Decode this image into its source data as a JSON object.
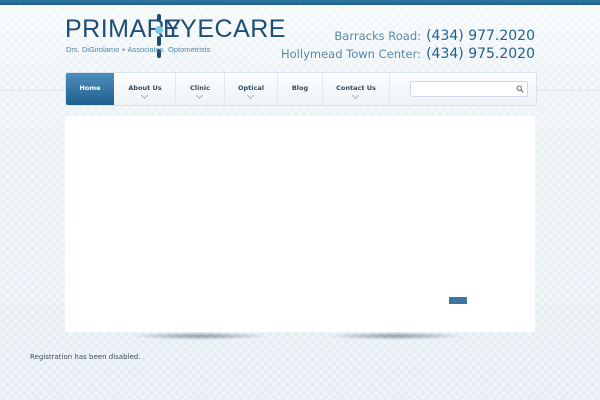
{
  "logo": {
    "primary": "PRIMARY",
    "eyecare": "EYECARE",
    "subtitle_left": "Drs. DiGirolamo + Associates",
    "subtitle_right": "Optometrists"
  },
  "contact": [
    {
      "label": "Barracks Road:",
      "number": "(434) 977.2020"
    },
    {
      "label": "Hollymead Town Center:",
      "number": "(434) 975.2020"
    }
  ],
  "nav": {
    "items": [
      {
        "label": "Home",
        "active": true
      },
      {
        "label": "About Us"
      },
      {
        "label": "Clinic"
      },
      {
        "label": "Optical"
      },
      {
        "label": "Blog"
      },
      {
        "label": "Contact Us"
      }
    ]
  },
  "search": {
    "value": "",
    "placeholder": ""
  },
  "footer": {
    "notice": "Registration has been disabled."
  },
  "colors": {
    "brand": "#1d4e76",
    "accent": "#7cc7e9",
    "nav_active": "#2f6f9e"
  }
}
